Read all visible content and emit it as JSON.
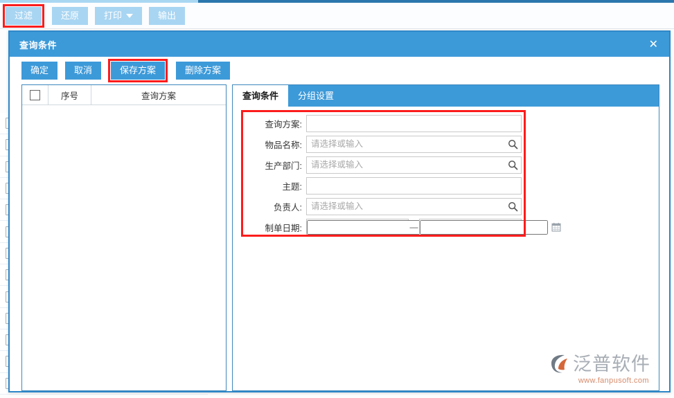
{
  "toolbar": {
    "buttons": [
      {
        "label": "过滤",
        "highlighted": true
      },
      {
        "label": "还原",
        "highlighted": false
      },
      {
        "label": "打印",
        "highlighted": false,
        "has_caret": true
      },
      {
        "label": "输出",
        "highlighted": false
      }
    ]
  },
  "dialog": {
    "title": "查询条件",
    "close_label": "✕",
    "actions": [
      {
        "label": "确定",
        "highlighted": false
      },
      {
        "label": "取消",
        "highlighted": false
      },
      {
        "label": "保存方案",
        "highlighted": true
      },
      {
        "label": "删除方案",
        "highlighted": false
      }
    ],
    "scheme_list": {
      "columns": [
        "",
        "序号",
        "查询方案"
      ],
      "rows": []
    },
    "tabs": [
      {
        "label": "查询条件",
        "active": true
      },
      {
        "label": "分组设置",
        "active": false
      }
    ],
    "form": {
      "fields": [
        {
          "label": "查询方案:",
          "value": "",
          "placeholder": "",
          "icon": "none"
        },
        {
          "label": "物品名称:",
          "value": "",
          "placeholder": "请选择或输入",
          "icon": "search-icon"
        },
        {
          "label": "生产部门:",
          "value": "",
          "placeholder": "请选择或输入",
          "icon": "search-icon"
        },
        {
          "label": "主题:",
          "value": "",
          "placeholder": "",
          "icon": "none"
        },
        {
          "label": "负责人:",
          "value": "",
          "placeholder": "请选择或输入",
          "icon": "search-icon"
        }
      ],
      "date_field": {
        "label": "制单日期:",
        "from_value": "",
        "from_placeholder": "",
        "separator": "—",
        "to_value": "",
        "to_placeholder": "",
        "icon": "calendar-icon"
      }
    }
  },
  "watermark": {
    "brand": "泛普软件",
    "url": "www.fanpusoft.com"
  },
  "colors": {
    "accent_blue": "#3d9ad9",
    "toolbar_blue": "#a8d5f2",
    "highlight_red": "#fc1c1c",
    "dialog_border": "#2e87c8",
    "panel_border": "#3d87bd"
  }
}
